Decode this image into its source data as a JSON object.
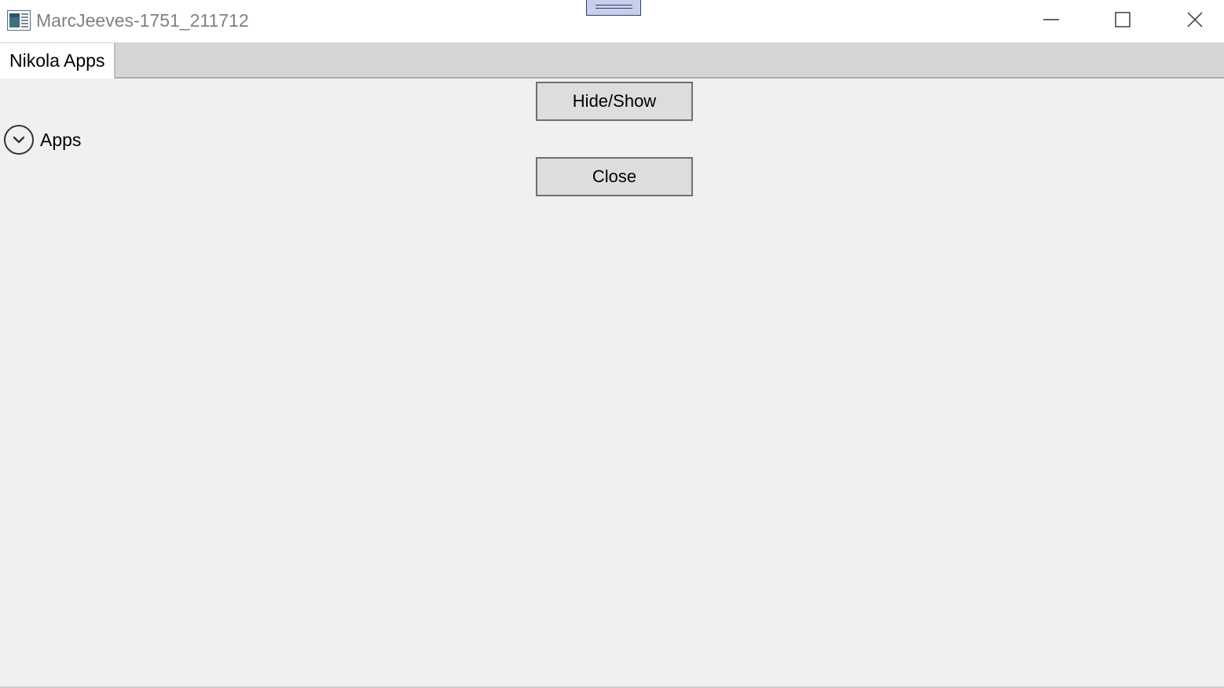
{
  "window": {
    "title": "MarcJeeves-1751_211712"
  },
  "tabs": [
    {
      "label": "Nikola Apps",
      "selected": true
    }
  ],
  "content": {
    "hide_show_label": "Hide/Show",
    "close_label": "Close",
    "expander": {
      "label": "Apps",
      "icon": "chevron-down-circle-icon",
      "expanded": false
    }
  },
  "colors": {
    "background": "#f0f0f0",
    "titlebar": "#ffffff",
    "tabstrip": "#d3d5d6",
    "button_face": "#dddddd",
    "button_border": "#707070",
    "grip_fill": "#c8d0e8",
    "grip_border": "#2a3f7a"
  },
  "icons": {
    "app": "app-window-icon",
    "minimize": "minimize-icon",
    "maximize": "maximize-icon",
    "close": "close-icon",
    "grip": "grip-handle-icon"
  }
}
